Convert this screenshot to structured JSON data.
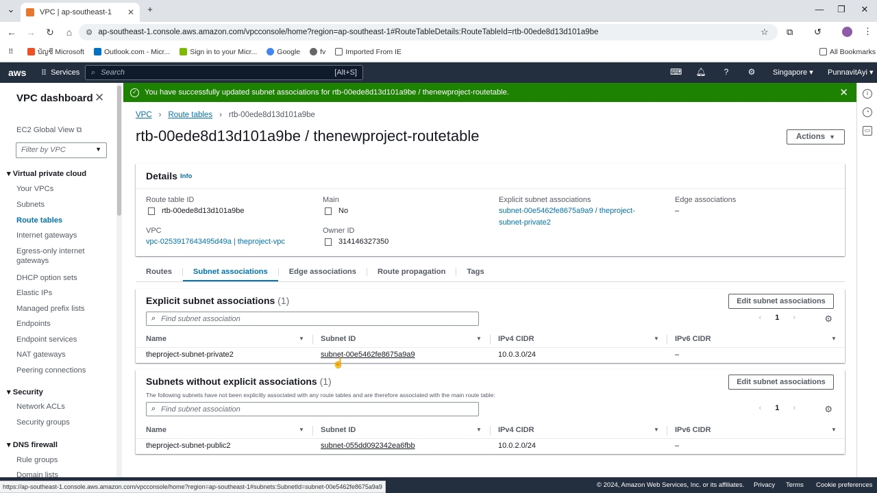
{
  "browser": {
    "tab_title": "VPC | ap-southeast-1",
    "url": "ap-southeast-1.console.aws.amazon.com/vpcconsole/home?region=ap-southeast-1#RouteTableDetails:RouteTableId=rtb-00ede8d13d101a9be",
    "bookmarks": [
      "บัญชี Microsoft",
      "Outlook.com - Micr...",
      "Sign in to your Micr...",
      "Google",
      "fv",
      "Imported From IE"
    ],
    "all_bookmarks": "All Bookmarks",
    "status_url": "https://ap-southeast-1.console.aws.amazon.com/vpcconsole/home?region=ap-southeast-1#subnets:SubnetId=subnet-00e5462fe8675a9a9"
  },
  "aws_header": {
    "logo": "aws",
    "services": "Services",
    "search_placeholder": "Search",
    "search_shortcut": "[Alt+S]",
    "region": "Singapore",
    "user": "PunnavitAyi"
  },
  "sidebar": {
    "title": "VPC dashboard",
    "ec2_global_view": "EC2 Global View",
    "filter_placeholder": "Filter by VPC",
    "sections": [
      {
        "title": "Virtual private cloud",
        "items": [
          "Your VPCs",
          "Subnets",
          "Route tables",
          "Internet gateways",
          "Egress-only internet gateways",
          "DHCP option sets",
          "Elastic IPs",
          "Managed prefix lists",
          "Endpoints",
          "Endpoint services",
          "NAT gateways",
          "Peering connections"
        ]
      },
      {
        "title": "Security",
        "items": [
          "Network ACLs",
          "Security groups"
        ]
      },
      {
        "title": "DNS firewall",
        "items": [
          "Rule groups",
          "Domain lists"
        ]
      }
    ],
    "egress_line1": "Egress-only internet",
    "egress_line2": "gateways"
  },
  "flash": {
    "message": "You have successfully updated subnet associations for rtb-00ede8d13d101a9be / thenewproject-routetable."
  },
  "breadcrumb": [
    "VPC",
    "Route tables",
    "rtb-00ede8d13d101a9be"
  ],
  "page": {
    "title": "rtb-00ede8d13d101a9be / thenewproject-routetable",
    "actions": "Actions"
  },
  "details": {
    "heading": "Details",
    "info": "Info",
    "route_table_id_label": "Route table ID",
    "route_table_id": "rtb-00ede8d13d101a9be",
    "main_label": "Main",
    "main": "No",
    "explicit_label": "Explicit subnet associations",
    "explicit_line1": "subnet-00e5462fe8675a9a9 / theproject-",
    "explicit_line2": "subnet-private2",
    "edge_label": "Edge associations",
    "edge": "–",
    "vpc_label": "VPC",
    "vpc": "vpc-0253917643495d49a | theproject-vpc",
    "owner_label": "Owner ID",
    "owner": "314146327350"
  },
  "tabs": [
    "Routes",
    "Subnet associations",
    "Edge associations",
    "Route propagation",
    "Tags"
  ],
  "explicit": {
    "heading": "Explicit subnet associations",
    "count": "(1)",
    "edit": "Edit subnet associations",
    "filter_placeholder": "Find subnet association",
    "page": "1",
    "columns": [
      "Name",
      "Subnet ID",
      "IPv4 CIDR",
      "IPv6 CIDR"
    ],
    "rows": [
      {
        "name": "theproject-subnet-private2",
        "subnet_id": "subnet-00e5462fe8675a9a9",
        "ipv4": "10.0.3.0/24",
        "ipv6": "–"
      }
    ]
  },
  "without": {
    "heading": "Subnets without explicit associations",
    "count": "(1)",
    "description": "The following subnets have not been explicitly associated with any route tables and are therefore associated with the main route table:",
    "edit": "Edit subnet associations",
    "filter_placeholder": "Find subnet association",
    "page": "1",
    "columns": [
      "Name",
      "Subnet ID",
      "IPv4 CIDR",
      "IPv6 CIDR"
    ],
    "rows": [
      {
        "name": "theproject-subnet-public2",
        "subnet_id": "subnet-055dd092342ea6fbb",
        "ipv4": "10.0.2.0/24",
        "ipv6": "–"
      }
    ]
  },
  "footer": {
    "copyright": "© 2024, Amazon Web Services, Inc. or its affiliates.",
    "privacy": "Privacy",
    "terms": "Terms",
    "cookies": "Cookie preferences"
  },
  "colors": {
    "aws_nav": "#232f3e",
    "success": "#1d8102",
    "link": "#0073bb"
  }
}
